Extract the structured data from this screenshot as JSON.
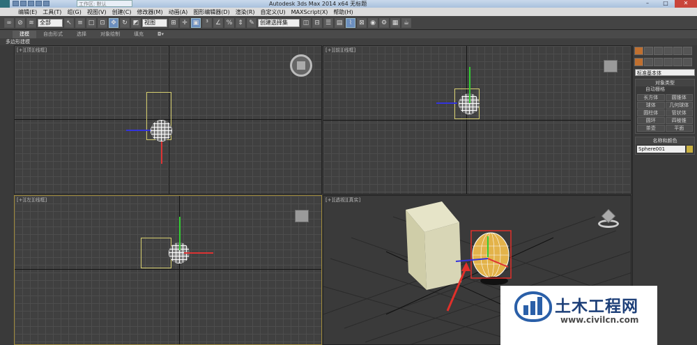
{
  "title_bar": {
    "workspace": "工作区: 默认",
    "title": "Autodesk 3ds Max  2014 x64     无标题"
  },
  "menu": [
    "编辑(E)",
    "工具(T)",
    "组(G)",
    "视图(V)",
    "创建(C)",
    "修改器(M)",
    "动画(A)",
    "图形编辑器(D)",
    "渲染(R)",
    "自定义(U)",
    "MAXScript(X)",
    "帮助(H)"
  ],
  "toolbar": {
    "filter_value": "全部",
    "view_value": "视图",
    "named_sel_value": "创建选择集"
  },
  "ribbon_tabs": [
    "建模",
    "自由形式",
    "选择",
    "对象绘制",
    "填充"
  ],
  "ribbon_sub": "多边形建模",
  "viewports": {
    "top_left": "[+][顶][线框]",
    "top_right": "[+][前][线框]",
    "bottom_left": "[+][左][线框]",
    "bottom_right": "[+][透视][真实]"
  },
  "command_panel": {
    "category": "标准基本体",
    "object_type_header": "对象类型",
    "autogrid_label": "自动栅格",
    "primitives": [
      "长方体",
      "圆锥体",
      "球体",
      "几何球体",
      "圆柱体",
      "管状体",
      "圆环",
      "四棱锥",
      "茶壶",
      "平面"
    ],
    "name_color_header": "名称和颜色",
    "object_name": "Sphere001",
    "object_color": "#c8b040"
  },
  "watermark": {
    "cn": "土木工程网",
    "url": "www.civilcn.com"
  }
}
